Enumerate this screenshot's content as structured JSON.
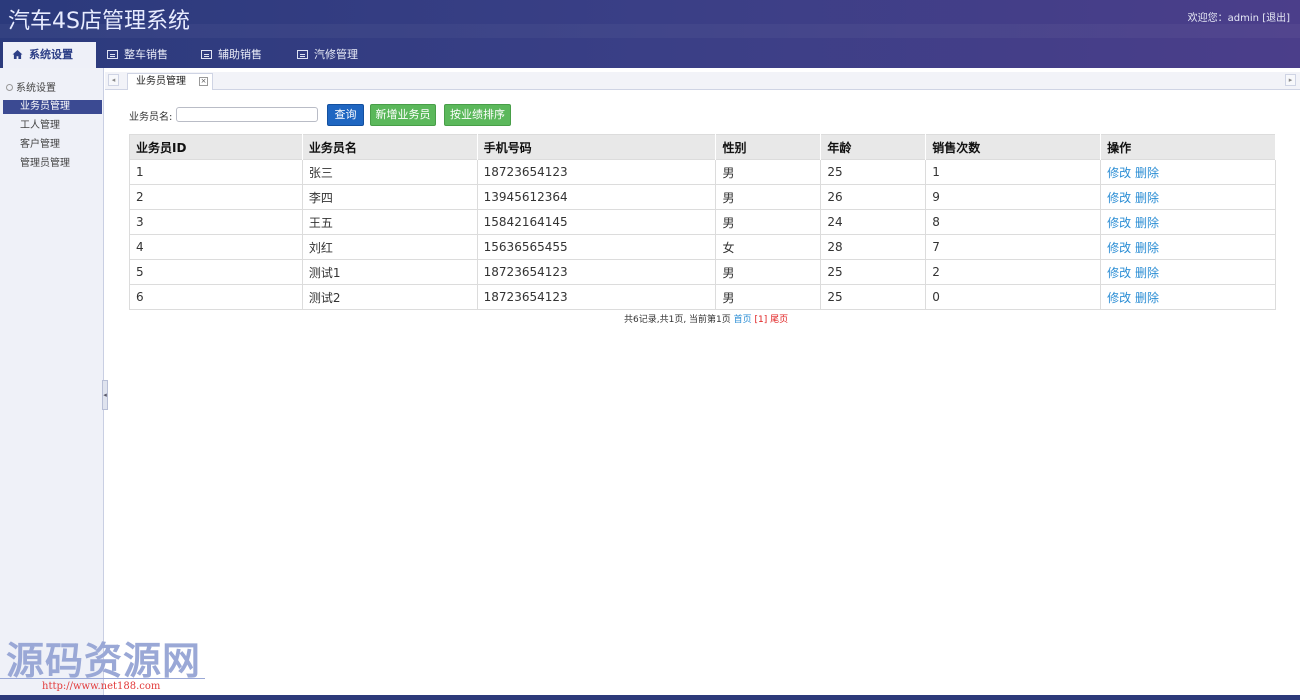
{
  "app": {
    "title": "汽车4S店管理系统",
    "welcome_prefix": "欢迎您：",
    "username": "admin",
    "logout_label": "[退出]"
  },
  "nav": {
    "tabs": [
      {
        "label": "系统设置",
        "icon": "home-icon"
      },
      {
        "label": "整车销售",
        "icon": "list-icon"
      },
      {
        "label": "辅助销售",
        "icon": "list-icon"
      },
      {
        "label": "汽修管理",
        "icon": "list-icon"
      }
    ]
  },
  "sidebar": {
    "section_title": "系统设置",
    "items": [
      {
        "label": "业务员管理"
      },
      {
        "label": "工人管理"
      },
      {
        "label": "客户管理"
      },
      {
        "label": "管理员管理"
      }
    ]
  },
  "page_tab": {
    "label": "业务员管理",
    "close_glyph": "×"
  },
  "search": {
    "label": "业务员名:",
    "value": "",
    "query_button": "查询",
    "add_button": "新增业务员",
    "sort_button": "按业绩排序"
  },
  "table": {
    "columns": [
      "业务员ID",
      "业务员名",
      "手机号码",
      "性别",
      "年龄",
      "销售次数",
      "操作"
    ],
    "rows": [
      {
        "id": "1",
        "name": "张三",
        "phone": "18723654123",
        "gender": "男",
        "age": "25",
        "sales": "1"
      },
      {
        "id": "2",
        "name": "李四",
        "phone": "13945612364",
        "gender": "男",
        "age": "26",
        "sales": "9"
      },
      {
        "id": "3",
        "name": "王五",
        "phone": "15842164145",
        "gender": "男",
        "age": "24",
        "sales": "8"
      },
      {
        "id": "4",
        "name": "刘红",
        "phone": "15636565455",
        "gender": "女",
        "age": "28",
        "sales": "7"
      },
      {
        "id": "5",
        "name": "测试1",
        "phone": "18723654123",
        "gender": "男",
        "age": "25",
        "sales": "2"
      },
      {
        "id": "6",
        "name": "测试2",
        "phone": "18723654123",
        "gender": "男",
        "age": "25",
        "sales": "0"
      }
    ],
    "edit_label": "修改",
    "delete_label": "删除"
  },
  "pager": {
    "summary": "共6记录,共1页, 当前第1页",
    "first_label": "首页",
    "current_page": "[1]",
    "last_label": "尾页"
  },
  "watermark": {
    "text": "源码资源网",
    "url": "http://www.net188.com"
  },
  "colors": {
    "header": "#34407f",
    "accent_blue": "#1f66c1",
    "accent_green": "#5bb85b",
    "link": "#2a8dd4",
    "sidebar_active": "#3b4a92"
  }
}
